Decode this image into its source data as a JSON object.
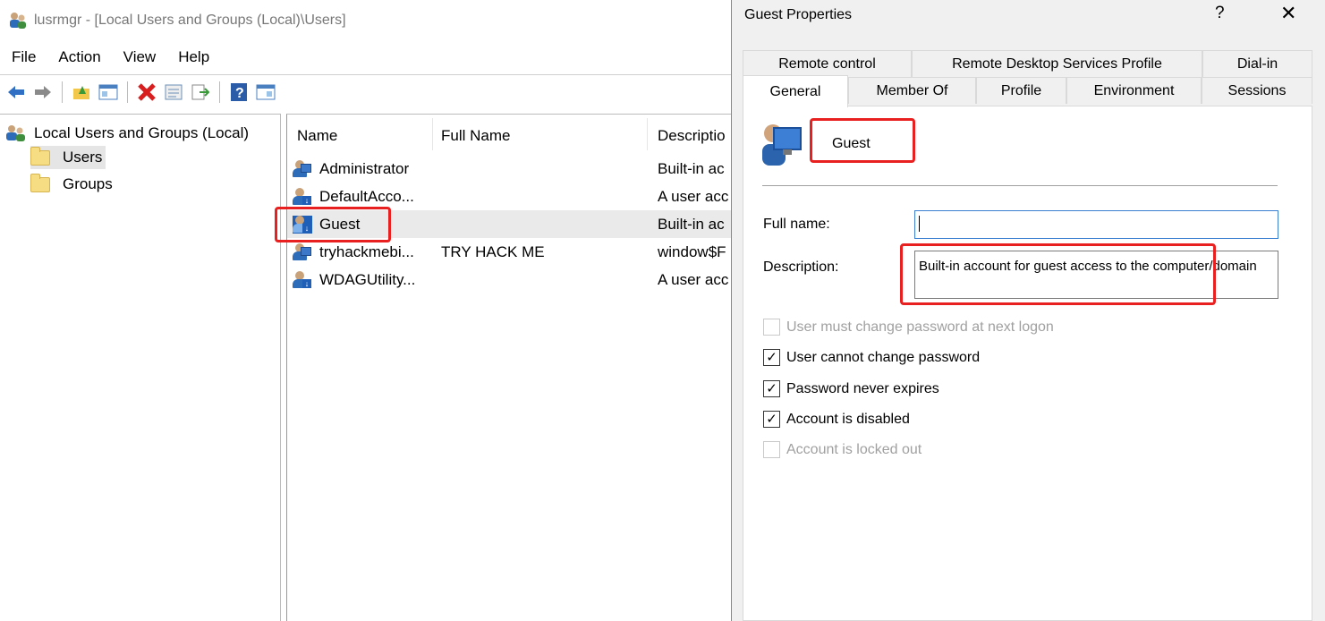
{
  "main_window": {
    "title": "lusrmgr - [Local Users and Groups (Local)\\Users]",
    "menu": [
      "File",
      "Action",
      "View",
      "Help"
    ],
    "toolbar_icons": [
      "back-arrow-icon",
      "forward-arrow-icon",
      "up-folder-icon",
      "show-hide-tree-icon",
      "delete-icon",
      "properties-icon",
      "export-list-icon",
      "help-icon",
      "show-hide-action-pane-icon"
    ],
    "tree": {
      "root": "Local Users and Groups (Local)",
      "items": [
        "Users",
        "Groups"
      ],
      "selected": "Users"
    },
    "list": {
      "columns": [
        "Name",
        "Full Name",
        "Descriptio"
      ],
      "rows": [
        {
          "name": "Administrator",
          "full_name": "",
          "description": "Built-in ac"
        },
        {
          "name": "DefaultAcco...",
          "full_name": "",
          "description": "A user acc"
        },
        {
          "name": "Guest",
          "full_name": "",
          "description": "Built-in ac"
        },
        {
          "name": "tryhackmebi...",
          "full_name": "TRY HACK ME",
          "description": "window$F"
        },
        {
          "name": "WDAGUtility...",
          "full_name": "",
          "description": "A user acc"
        }
      ],
      "selected_row": "Guest"
    }
  },
  "dialog": {
    "title": "Guest Properties",
    "help_label": "?",
    "close_label": "✕",
    "tabs_row1": [
      "Remote control",
      "Remote Desktop Services Profile",
      "Dial-in"
    ],
    "tabs_row2": [
      "General",
      "Member Of",
      "Profile",
      "Environment",
      "Sessions"
    ],
    "active_tab": "General",
    "username": "Guest",
    "full_name_label": "Full name:",
    "full_name_value": "",
    "description_label": "Description:",
    "description_value": "Built-in account for guest access to the computer/domain",
    "checkboxes": [
      {
        "label": "User must change password at next logon",
        "checked": false,
        "enabled": false
      },
      {
        "label": "User cannot change password",
        "checked": true,
        "enabled": true
      },
      {
        "label": "Password never expires",
        "checked": true,
        "enabled": true
      },
      {
        "label": "Account is disabled",
        "checked": true,
        "enabled": true
      },
      {
        "label": "Account is locked out",
        "checked": false,
        "enabled": false
      }
    ],
    "check_mark": "✓"
  },
  "annotation_color": "#e8201f"
}
